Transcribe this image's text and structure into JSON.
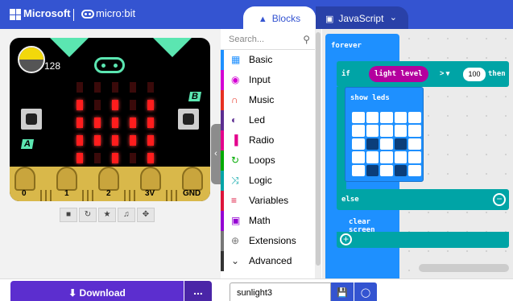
{
  "header": {
    "brand": "Microsoft",
    "product": "micro:bit",
    "tabs": [
      {
        "label": "Blocks",
        "icon": "puzzle-icon",
        "active": true
      },
      {
        "label": "JavaScript",
        "icon": "code-icon",
        "active": false
      }
    ],
    "colors": {
      "bar": "#3454d1"
    }
  },
  "simulator": {
    "light_level_readout": "128",
    "button_a": "A",
    "button_b": "B",
    "pins": [
      "0",
      "1",
      "2",
      "3V",
      "GND"
    ],
    "leds": [
      [
        0,
        0,
        0,
        0,
        0
      ],
      [
        1,
        0,
        1,
        0,
        1
      ],
      [
        1,
        1,
        1,
        1,
        1
      ],
      [
        1,
        1,
        1,
        1,
        1
      ],
      [
        1,
        0,
        1,
        0,
        1
      ]
    ],
    "toolbar_icons": [
      "stop-icon",
      "restart-icon",
      "slowmo-icon",
      "audio-icon",
      "fullscreen-icon"
    ]
  },
  "toolbox": {
    "search_placeholder": "Search...",
    "categories": [
      {
        "label": "Basic",
        "color": "#1e90ff",
        "icon": "grid-icon"
      },
      {
        "label": "Input",
        "color": "#d400d4",
        "icon": "circle-icon"
      },
      {
        "label": "Music",
        "color": "#e63022",
        "icon": "headphones-icon"
      },
      {
        "label": "Led",
        "color": "#5c2d91",
        "icon": "toggle-icon"
      },
      {
        "label": "Radio",
        "color": "#e3008c",
        "icon": "signal-icon"
      },
      {
        "label": "Loops",
        "color": "#00aa00",
        "icon": "refresh-icon"
      },
      {
        "label": "Logic",
        "color": "#00a4a6",
        "icon": "shuffle-icon"
      },
      {
        "label": "Variables",
        "color": "#dc143c",
        "icon": "list-icon"
      },
      {
        "label": "Math",
        "color": "#9400d3",
        "icon": "calculator-icon"
      },
      {
        "label": "Extensions",
        "color": "#777777",
        "icon": "plus-icon"
      },
      {
        "label": "Advanced",
        "color": "#333333",
        "icon": "chevron-down-icon"
      }
    ]
  },
  "workspace": {
    "forever_label": "forever",
    "if_label": "if",
    "condition_reporter": "light level",
    "operator": ">",
    "compare_value": "100",
    "then_label": "then",
    "show_leds_label": "show leds",
    "led_pattern": [
      [
        1,
        1,
        1,
        1,
        1
      ],
      [
        1,
        1,
        1,
        1,
        1
      ],
      [
        1,
        0,
        1,
        0,
        1
      ],
      [
        1,
        1,
        1,
        1,
        1
      ],
      [
        1,
        0,
        1,
        0,
        1
      ]
    ],
    "else_label": "else",
    "clear_screen_label": "clear screen"
  },
  "footer": {
    "download_label": "Download",
    "more_label": "...",
    "project_name": "sunlight3"
  }
}
